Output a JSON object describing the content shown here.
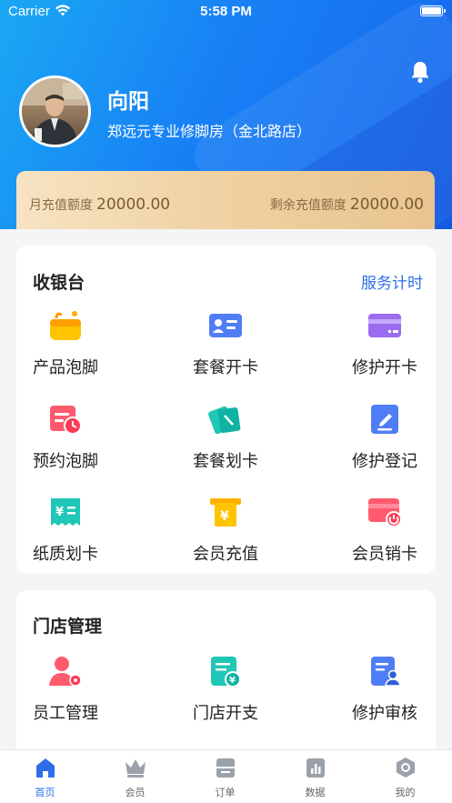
{
  "status_bar": {
    "carrier": "Carrier",
    "time": "5:58 PM"
  },
  "profile": {
    "name": "向阳",
    "store": "郑远元专业修脚房（金北路店）"
  },
  "quota": {
    "monthly_label": "月充值额度",
    "monthly_value": "20000.00",
    "remaining_label": "剩余充值额度",
    "remaining_value": "20000.00"
  },
  "cashier": {
    "title": "收银台",
    "action": "服务计时",
    "items": [
      {
        "label": "产品泡脚",
        "icon": "basket-icon"
      },
      {
        "label": "套餐开卡",
        "icon": "id-card-icon"
      },
      {
        "label": "修护开卡",
        "icon": "credit-card-icon"
      },
      {
        "label": "预约泡脚",
        "icon": "calendar-clock-icon"
      },
      {
        "label": "套餐划卡",
        "icon": "swipe-card-icon"
      },
      {
        "label": "修护登记",
        "icon": "edit-document-icon"
      },
      {
        "label": "纸质划卡",
        "icon": "paper-ticket-icon"
      },
      {
        "label": "会员充值",
        "icon": "recharge-icon"
      },
      {
        "label": "会员销卡",
        "icon": "cancel-card-icon"
      }
    ]
  },
  "store_mgmt": {
    "title": "门店管理",
    "items": [
      {
        "label": "员工管理",
        "icon": "staff-settings-icon"
      },
      {
        "label": "门店开支",
        "icon": "expense-icon"
      },
      {
        "label": "修护审核",
        "icon": "review-icon"
      }
    ]
  },
  "tabbar": [
    {
      "label": "首页",
      "icon": "home-icon",
      "active": true
    },
    {
      "label": "会员",
      "icon": "crown-icon",
      "active": false
    },
    {
      "label": "订单",
      "icon": "order-icon",
      "active": false
    },
    {
      "label": "数据",
      "icon": "chart-icon",
      "active": false
    },
    {
      "label": "我的",
      "icon": "profile-hex-icon",
      "active": false
    }
  ],
  "colors": {
    "primary": "#2f6ee8",
    "header_start": "#1aa8f3",
    "header_end": "#1565ec",
    "gold": "#e8c48f"
  }
}
